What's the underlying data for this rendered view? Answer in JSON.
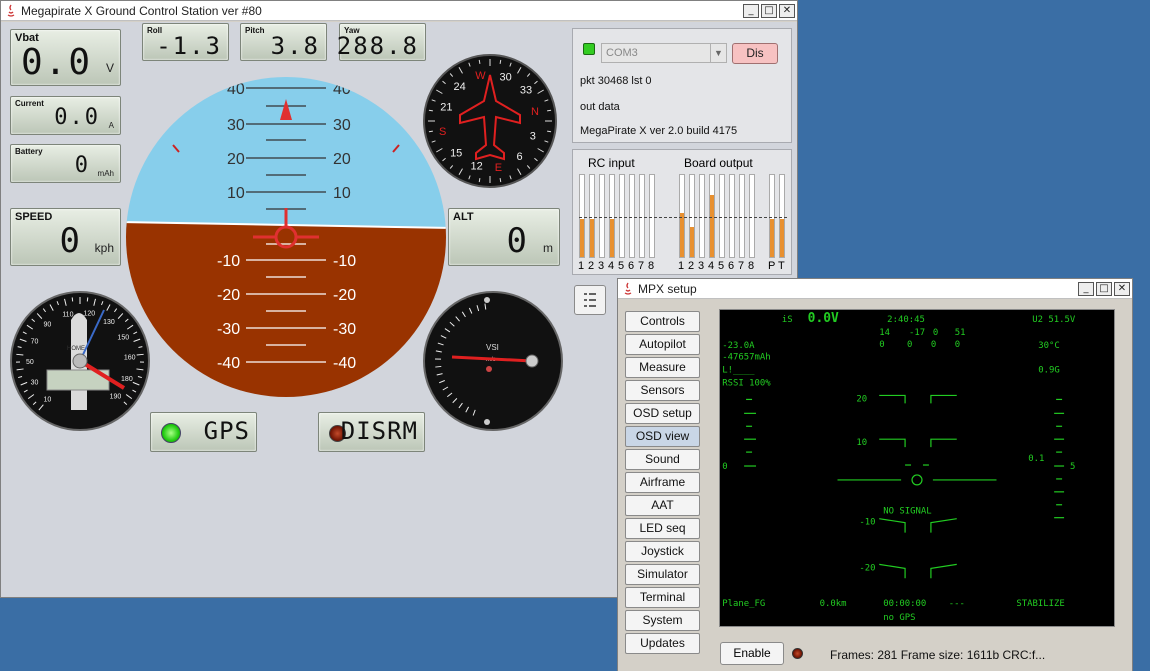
{
  "main_window": {
    "title": "Megapirate X Ground Control Station ver #80",
    "vbat": {
      "label": "Vbat",
      "value": "0.0",
      "unit": "V"
    },
    "current": {
      "label": "Current",
      "value": "0.0",
      "unit": "A"
    },
    "battery": {
      "label": "Battery",
      "value": "0",
      "unit": "mAh"
    },
    "speed": {
      "label": "SPEED",
      "value": "0",
      "unit": "kph"
    },
    "alt": {
      "label": "ALT",
      "value": "0",
      "unit": "m"
    },
    "roll": {
      "label": "Roll",
      "value": "-1.3"
    },
    "pitch": {
      "label": "Pitch",
      "value": "3.8"
    },
    "yaw": {
      "label": "Yaw",
      "value": "288.8"
    },
    "gps_label": "GPS",
    "disarm_label": "DISRM",
    "connection": {
      "port": "COM3",
      "button": "Dis",
      "pkt": "pkt 30468 lst 0",
      "out": "out data",
      "version": "MegaPirate X ver 2.0 build 4175"
    },
    "rc": {
      "rc_title": "RC input",
      "board_title": "Board output",
      "rc_channels": [
        "1",
        "2",
        "3",
        "4",
        "5",
        "6",
        "7",
        "8"
      ],
      "board_channels": [
        "1",
        "2",
        "3",
        "4",
        "5",
        "6",
        "7",
        "8"
      ],
      "pt_channels": [
        "P",
        "T"
      ]
    },
    "horizon": {
      "pitch_labels_top": [
        "40",
        "30",
        "20",
        "10"
      ],
      "pitch_labels_bottom": [
        "-10",
        "-20",
        "-30",
        "-40"
      ]
    },
    "compass": {
      "labels": [
        "W",
        "30",
        "33",
        "N",
        "3",
        "6",
        "E",
        "12",
        "15",
        "S",
        "21",
        "24"
      ]
    },
    "airspeed": {
      "home": "HOME",
      "ticks": [
        "10",
        "30",
        "50",
        "70",
        "90",
        "110",
        "120",
        "130",
        "150",
        "160",
        "180",
        "190"
      ]
    },
    "vsi": {
      "label": "VSI",
      "unit": "m/s"
    }
  },
  "setup_window": {
    "title": "MPX setup",
    "nav": [
      "Controls",
      "Autopilot",
      "Measure",
      "Sensors",
      "OSD setup",
      "OSD view",
      "Sound",
      "Airframe",
      "AAT",
      "LED seq",
      "Joystick",
      "Simulator",
      "Terminal",
      "System",
      "Updates"
    ],
    "active_nav": "OSD view",
    "enable_label": "Enable",
    "frames_text": "Frames: 281 Frame size: 1611b CRC:f...",
    "osd": {
      "top": [
        "iS",
        "0.0V",
        "2:40:45",
        "U2  51.5V"
      ],
      "row2": [
        "14",
        "-17",
        "0",
        "51"
      ],
      "row3": [
        "0",
        "0",
        "0",
        "0"
      ],
      "left": [
        "-23.0A",
        "-47657mAh",
        "L!____",
        "RSSI 100%"
      ],
      "right": [
        "30°C",
        "0.9G"
      ],
      "ladder": [
        "20",
        "10",
        "-10",
        "-20"
      ],
      "vario_right": [
        "0.1",
        "5"
      ],
      "left_zero": "0",
      "no_signal": "NO SIGNAL",
      "bottom": [
        "Plane_FG",
        "0.0km",
        "00:00:00",
        "---",
        "STABILIZE"
      ],
      "no_gps": "no GPS"
    }
  },
  "colors": {
    "sky": "#87ceeb",
    "ground": "#993300",
    "lcd_green": "#c6d2c0",
    "osd_green": "#22cc22",
    "led_green": "#44ee33",
    "led_red": "#8a1a0a"
  }
}
